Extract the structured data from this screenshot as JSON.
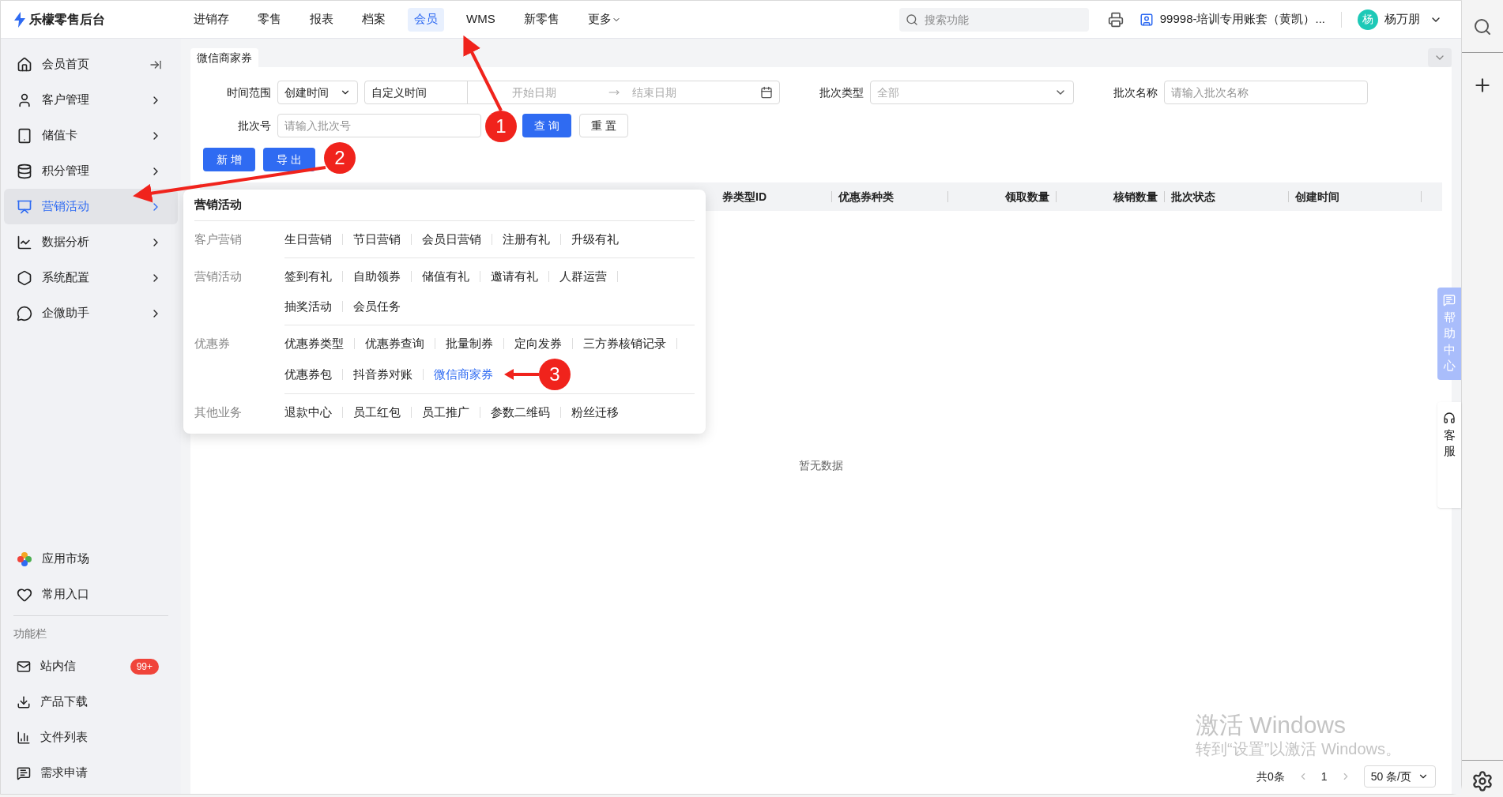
{
  "app": {
    "name": "乐檬零售后台"
  },
  "nav": [
    {
      "label": "进销存",
      "selected": false
    },
    {
      "label": "零售",
      "selected": false
    },
    {
      "label": "报表",
      "selected": false
    },
    {
      "label": "档案",
      "selected": false
    },
    {
      "label": "会员",
      "selected": true
    },
    {
      "label": "WMS",
      "selected": false
    },
    {
      "label": "新零售",
      "selected": false
    },
    {
      "label": "更多",
      "selected": false
    }
  ],
  "search": {
    "placeholder": "搜索功能"
  },
  "account": "99998-培训专用账套（黄凯）...",
  "user": {
    "avatar": "杨",
    "name": "杨万朋"
  },
  "sidebar": {
    "items": [
      {
        "label": "会员首页",
        "selected": false
      },
      {
        "label": "客户管理",
        "selected": false
      },
      {
        "label": "储值卡",
        "selected": false
      },
      {
        "label": "积分管理",
        "selected": false
      },
      {
        "label": "营销活动",
        "selected": true
      },
      {
        "label": "数据分析",
        "selected": false
      },
      {
        "label": "系统配置",
        "selected": false
      },
      {
        "label": "企微助手",
        "selected": false
      }
    ],
    "shortcuts": [
      "应用市场",
      "常用入口"
    ],
    "section_title": "功能栏",
    "tools": [
      {
        "label": "站内信",
        "badge": "99+"
      },
      {
        "label": "产品下载"
      },
      {
        "label": "文件列表"
      },
      {
        "label": "需求申请"
      }
    ]
  },
  "tab": "微信商家券",
  "filters": {
    "time_range_label": "时间范围",
    "time_field": "创建时间",
    "range_mode": "自定义时间",
    "start_placeholder": "开始日期",
    "end_placeholder": "结束日期",
    "batch_type_label": "批次类型",
    "batch_type_placeholder": "全部",
    "batch_name_label": "批次名称",
    "batch_name_placeholder": "请输入批次名称",
    "batch_no_label": "批次号",
    "batch_no_placeholder": "请输入批次号",
    "query": "查 询",
    "reset": "重 置"
  },
  "actions": [
    "新 增",
    "导 出"
  ],
  "table": {
    "columns": [
      "券类型ID",
      "优惠券种类",
      "领取数量",
      "核销数量",
      "批次状态",
      "创建时间"
    ],
    "empty": "暂无数据"
  },
  "menu": {
    "title": "营销活动",
    "groups": [
      {
        "label": "客户营销",
        "rows": [
          [
            {
              "label": "生日营销",
              "selected": false
            },
            {
              "label": "节日营销",
              "selected": false
            },
            {
              "label": "会员日营销",
              "selected": false
            },
            {
              "label": "注册有礼",
              "selected": false
            },
            {
              "label": "升级有礼",
              "selected": false
            }
          ]
        ]
      },
      {
        "label": "营销活动",
        "rows": [
          [
            {
              "label": "签到有礼",
              "selected": false
            },
            {
              "label": "自助领券",
              "selected": false
            },
            {
              "label": "储值有礼",
              "selected": false
            },
            {
              "label": "邀请有礼",
              "selected": false
            },
            {
              "label": "人群运营",
              "selected": false
            }
          ],
          [
            {
              "label": "抽奖活动",
              "selected": false
            },
            {
              "label": "会员任务",
              "selected": false
            }
          ]
        ]
      },
      {
        "label": "优惠券",
        "rows": [
          [
            {
              "label": "优惠券类型",
              "selected": false
            },
            {
              "label": "优惠券查询",
              "selected": false
            },
            {
              "label": "批量制券",
              "selected": false
            },
            {
              "label": "定向发券",
              "selected": false
            },
            {
              "label": "三方券核销记录",
              "selected": false
            }
          ],
          [
            {
              "label": "优惠券包",
              "selected": false
            },
            {
              "label": "抖音券对账",
              "selected": false
            },
            {
              "label": "微信商家券",
              "selected": true
            }
          ]
        ]
      },
      {
        "label": "其他业务",
        "rows": [
          [
            {
              "label": "退款中心",
              "selected": false
            },
            {
              "label": "员工红包",
              "selected": false
            },
            {
              "label": "员工推广",
              "selected": false
            },
            {
              "label": "参数二维码",
              "selected": false
            },
            {
              "label": "粉丝迁移",
              "selected": false
            }
          ]
        ]
      }
    ]
  },
  "side_tabs": [
    "帮助中心",
    "客服"
  ],
  "pagination": {
    "total": "共0条",
    "page": "1",
    "page_size": "50 条/页"
  },
  "os_notice": {
    "title": "激活 Windows",
    "text": "转到“设置”以激活 Windows。"
  },
  "annotations": [
    {
      "label": "1"
    },
    {
      "label": "2"
    },
    {
      "label": "3"
    }
  ]
}
